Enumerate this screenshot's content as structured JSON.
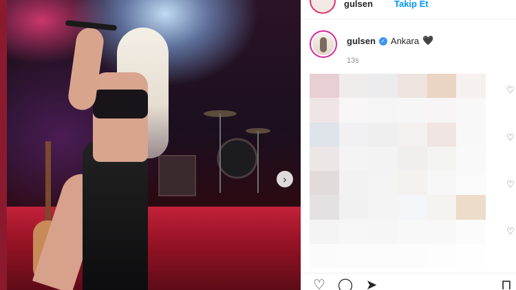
{
  "post": {
    "top_username": "gulsen",
    "top_follow": "Takip Et",
    "username": "gulsen",
    "caption": "Ankara",
    "caption_emoji": "🖤",
    "timestamp": "13s"
  },
  "icons": {
    "verified": "verified-badge-icon",
    "next": "chevron-right-icon",
    "like": "heart-outline-icon",
    "comment": "comment-bubble-icon",
    "share": "paper-plane-icon",
    "save": "bookmark-icon"
  },
  "glyphs": {
    "verified": "✓",
    "next": "›",
    "like": "♡",
    "comment": "◯",
    "share": "➤",
    "save": "⊓"
  },
  "colors": {
    "follow": "#0095f6",
    "verified": "#3897f0",
    "avatar_ring": "#d6249f"
  }
}
